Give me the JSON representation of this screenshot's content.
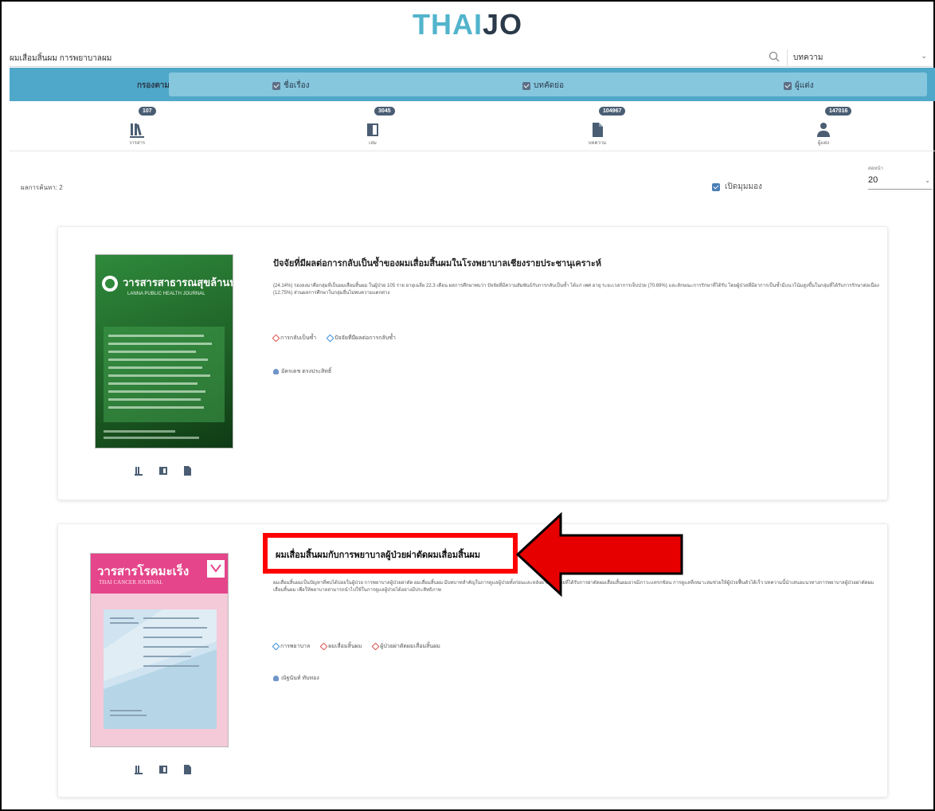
{
  "header": {
    "logo_part1": "THAI",
    "logo_part2": "JO"
  },
  "search": {
    "query": "ผมเสื่อมสิ้นผม การพยาบาลผม",
    "scope": "บทความ"
  },
  "filter": {
    "label": "กรองตาม",
    "options": [
      {
        "label": "ชื่อเรื่อง"
      },
      {
        "label": "บทคัดย่อ"
      },
      {
        "label": "ผู้แต่ง"
      }
    ]
  },
  "stats": [
    {
      "count": "107",
      "label": "วารสาร",
      "icon": "journals-icon"
    },
    {
      "count": "3045",
      "label": "เล่ม",
      "icon": "issues-icon"
    },
    {
      "count": "104967",
      "label": "บทความ",
      "icon": "articles-icon"
    },
    {
      "count": "147016",
      "label": "ผู้แต่ง",
      "icon": "authors-icon"
    }
  ],
  "results": {
    "count_text": "ผลการค้นหา: 2",
    "toggle_label": "เปิดมุมมอง",
    "per_page_caption": "ต่อหน้า",
    "per_page": "20"
  },
  "articles": [
    {
      "title": "ปัจจัยที่มีผลต่อการกลับเป็นซ้ำของผมเสื่อมสิ้นผมในโรงพยาบาลเชียงรายประชานุเคราะห์",
      "abstract": "(24.14%) รองลงมาคือกลุ่มที่เป็นผมเสื่อมสิ้นผม ในผู้ป่วย 105 ราย อายุเฉลี่ย 22.3 เดือน ผลการศึกษาพบว่า ปัจจัยที่มีความสัมพันธ์กับการกลับเป็นซ้ำ ได้แก่ เพศ อายุ ระยะเวลาการเจ็บป่วย (70.69%) และลักษณะการรักษาที่ได้รับ โดยผู้ป่วยที่มีอาการเป็นซ้ำมีแนวโน้มสูงขึ้นในกลุ่มที่ได้รับการรักษาต่อเนื่อง (12.75%) ส่วนผลการศึกษาในกลุ่มอื่นไม่พบความแตกต่าง",
      "keywords": [
        {
          "label": "การกลับเป็นซ้ำ",
          "tone": "red"
        },
        {
          "label": "ปัจจัยที่มีผลต่อการกลับซ้ำ",
          "tone": "blue"
        }
      ],
      "author": "อัครเดช ตรงประสิทธิ์",
      "cover": {
        "title": "วารสารสาธารณสุขล้านนา",
        "subtitle": "LANNA PUBLIC HEALTH JOURNAL"
      }
    },
    {
      "title": "ผมเสื่อมสิ้นผมกับการพยาบาลผู้ป่วยผ่าตัดผมเสื่อมสิ้นผม",
      "abstract": "ผมเสื่อมสิ้นผมเป็นปัญหาที่พบได้บ่อยในผู้ป่วย การพยาบาลผู้ป่วยผ่าตัด ผมเสื่อมสิ้นผม มีบทบาทสำคัญในการดูแลผู้ป่วยทั้งก่อนและหลังผ่าตัด ผู้ป่วยที่ได้รับการผ่าตัดผมเสื่อมสิ้นผมอาจมีภาวะแทรกซ้อน การดูแลที่เหมาะสมช่วยให้ผู้ป่วยฟื้นตัวได้เร็ว บทความนี้นำเสนอแนวทางการพยาบาลผู้ป่วยผ่าตัดผมเสื่อมสิ้นผม เพื่อให้พยาบาลสามารถนำไปใช้ในการดูแลผู้ป่วยได้อย่างมีประสิทธิภาพ",
      "keywords": [
        {
          "label": "การพยาบาล",
          "tone": "blue"
        },
        {
          "label": "ผมเสื่อมสิ้นผม",
          "tone": "red"
        },
        {
          "label": "ผู้ป่วยผ่าตัดผมเสื่อมสิ้นผม",
          "tone": "red"
        }
      ],
      "author": "ณัฐนันท์ ทับทอง",
      "cover": {
        "title": "วารสารโรคมะเร็ง",
        "subtitle": "THAI CANCER JOURNAL"
      }
    }
  ],
  "colors": {
    "accent": "#4fa8c9",
    "highlight_box": "#ff0000"
  }
}
